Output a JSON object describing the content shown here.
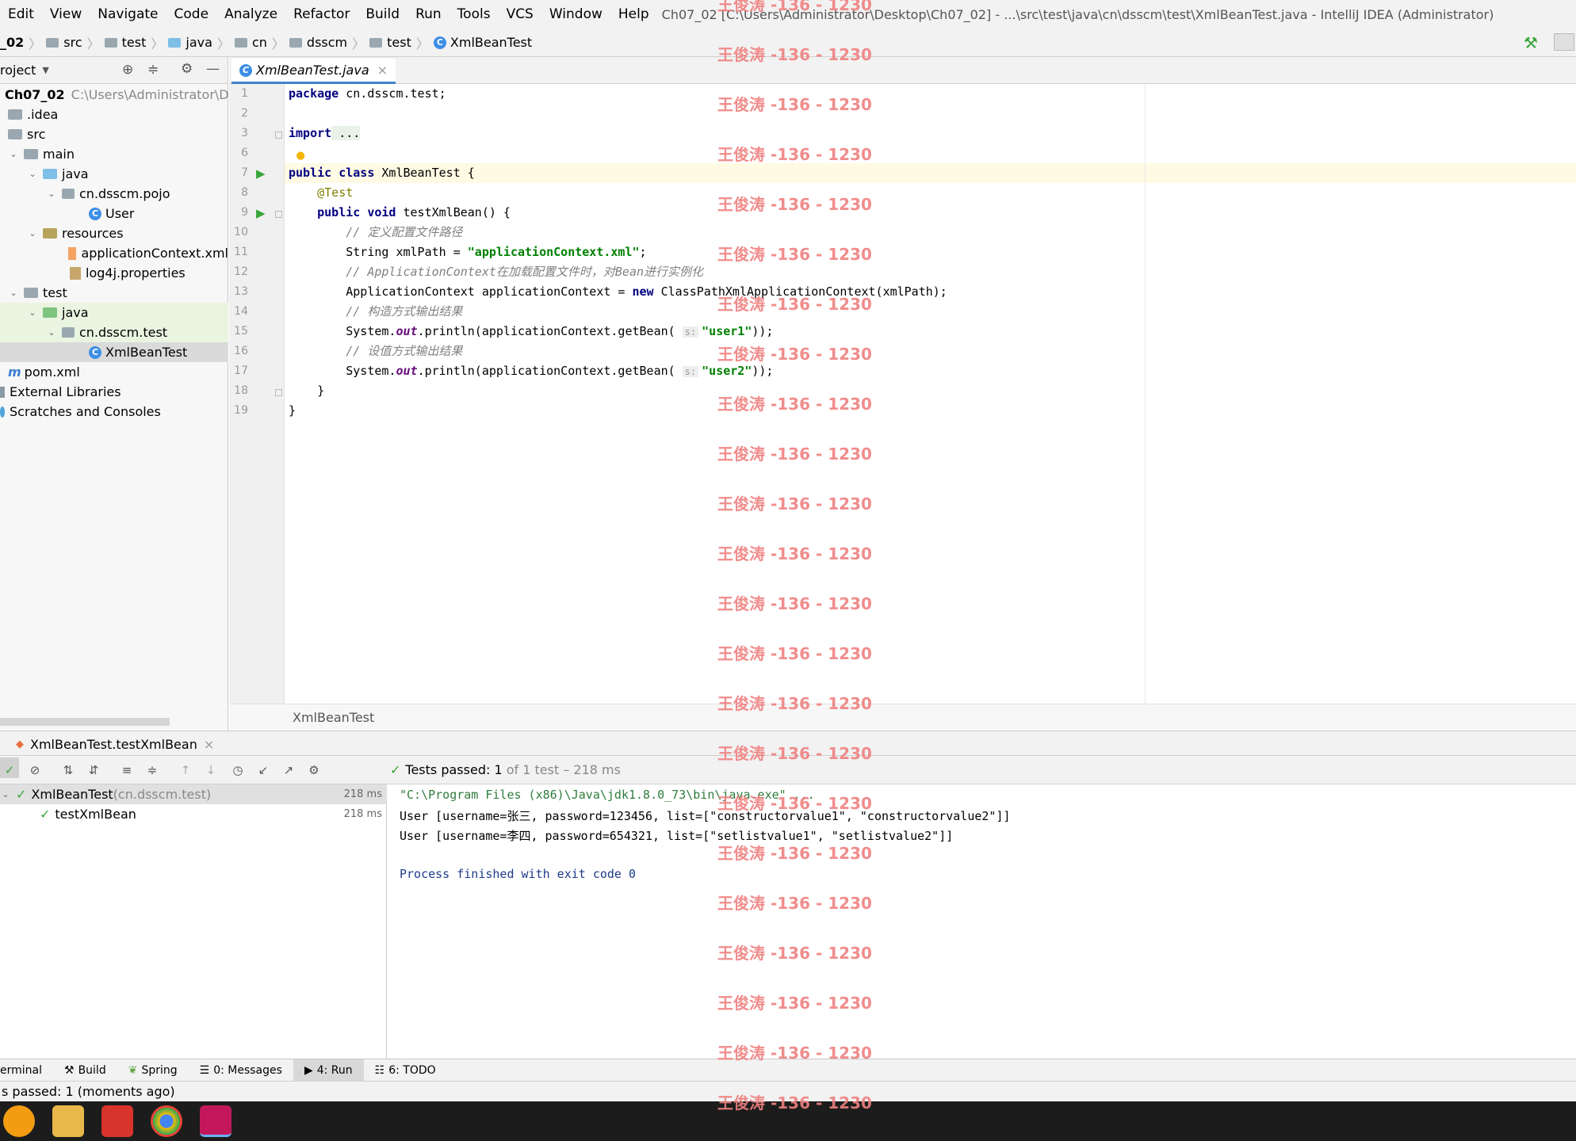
{
  "menu": {
    "items": [
      "Edit",
      "View",
      "Navigate",
      "Code",
      "Analyze",
      "Refactor",
      "Build",
      "Run",
      "Tools",
      "VCS",
      "Window",
      "Help"
    ],
    "window_title": "Ch07_02 [C:\\Users\\Administrator\\Desktop\\Ch07_02] - ...\\src\\test\\java\\cn\\dsscm\\test\\XmlBeanTest.java - IntelliJ IDEA (Administrator)"
  },
  "breadcrumbs": [
    "_02",
    "src",
    "test",
    "java",
    "cn",
    "dsscm",
    "test",
    "XmlBeanTest"
  ],
  "project": {
    "header": "roject",
    "tree": [
      {
        "label": "Ch07_02",
        "extra": "C:\\Users\\Administrator\\Desk",
        "kind": "root"
      },
      {
        "label": ".idea",
        "kind": "folder"
      },
      {
        "label": "src",
        "kind": "folder"
      },
      {
        "label": "main",
        "kind": "folder"
      },
      {
        "label": "java",
        "kind": "src"
      },
      {
        "label": "cn.dsscm.pojo",
        "kind": "pkg"
      },
      {
        "label": "User",
        "kind": "class"
      },
      {
        "label": "resources",
        "kind": "res"
      },
      {
        "label": "applicationContext.xml",
        "kind": "xml"
      },
      {
        "label": "log4j.properties",
        "kind": "prop"
      },
      {
        "label": "test",
        "kind": "folder"
      },
      {
        "label": "java",
        "kind": "src"
      },
      {
        "label": "cn.dsscm.test",
        "kind": "pkg"
      },
      {
        "label": "XmlBeanTest",
        "kind": "class"
      },
      {
        "label": "pom.xml",
        "kind": "maven"
      },
      {
        "label": "External Libraries",
        "kind": "lib"
      },
      {
        "label": "Scratches and Consoles",
        "kind": "scratch"
      }
    ]
  },
  "editor": {
    "tab_label": "XmlBeanTest.java",
    "line_numbers": [
      "1",
      "2",
      "3",
      "6",
      "7",
      "8",
      "9",
      "10",
      "11",
      "12",
      "13",
      "14",
      "15",
      "16",
      "17",
      "18",
      "19"
    ],
    "code": {
      "l1_kw": "package",
      "l1_rest": " cn.dsscm.test;",
      "l3_kw": "import",
      "l3_rest": " ...",
      "l7_kw": "public class",
      "l7_rest": " XmlBeanTest {",
      "l8": "    @Test",
      "l9_kw": "    public void",
      "l9_rest": " testXmlBean() {",
      "l10": "        // 定义配置文件路径",
      "l11_a": "        String xmlPath = ",
      "l11_str": "\"applicationContext.xml\"",
      "l11_b": ";",
      "l12": "        // ApplicationContext在加载配置文件时，对Bean进行实例化",
      "l13_a": "        ApplicationContext applicationContext = ",
      "l13_kw": "new",
      "l13_b": " ClassPathXmlApplicationContext(xmlPath);",
      "l14": "        // 构造方式输出结果",
      "l15_a": "        System.",
      "l15_fld": "out",
      "l15_b": ".println(applicationContext.getBean( ",
      "l15_hint": "s:",
      "l15_str": "\"user1\"",
      "l15_c": "));",
      "l16": "        // 设值方式输出结果",
      "l17_a": "        System.",
      "l17_fld": "out",
      "l17_b": ".println(applicationContext.getBean( ",
      "l17_hint": "s:",
      "l17_str": "\"user2\"",
      "l17_c": "));",
      "l18": "    }",
      "l19": "}"
    },
    "breadcrumb": "XmlBeanTest"
  },
  "run": {
    "tab_label": "XmlBeanTest.testXmlBean",
    "status_prefix": "Tests passed: ",
    "status_count": "1",
    "status_suffix": " of 1 test – 218 ms",
    "results": [
      {
        "label": "XmlBeanTest",
        "pkg": " (cn.dsscm.test)",
        "time": "218 ms"
      },
      {
        "label": "testXmlBean",
        "pkg": "",
        "time": "218 ms"
      }
    ],
    "console": [
      "\"C:\\Program Files (x86)\\Java\\jdk1.8.0_73\\bin\\java.exe\" ...",
      "User [username=张三, password=123456, list=[\"constructorvalue1\", \"constructorvalue2\"]]",
      "User [username=李四, password=654321, list=[\"setlistvalue1\", \"setlistvalue2\"]]",
      "",
      "Process finished with exit code 0"
    ]
  },
  "toolwindows": [
    "erminal",
    "Build",
    "Spring",
    "0: Messages",
    "4: Run",
    "6: TODO"
  ],
  "statusbar": "s passed: 1 (moments ago)",
  "watermark": "王俊涛 -136 - 1230",
  "colors": {
    "accent": "#4083c9",
    "pass": "#3aa53a",
    "watermark": "#f08080"
  }
}
